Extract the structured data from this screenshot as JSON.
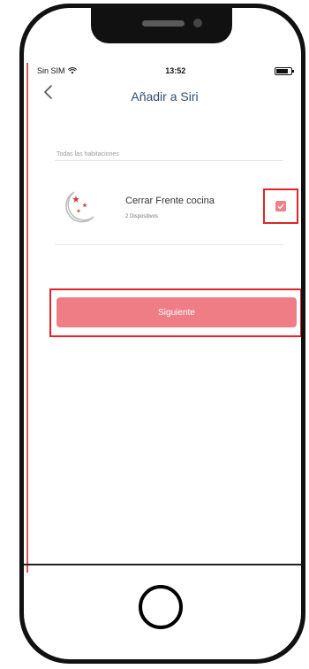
{
  "status_bar": {
    "carrier": "Sin SIM",
    "time": "13:52",
    "wifi_icon": "wifi-icon",
    "battery_icon": "battery-icon"
  },
  "nav": {
    "back_icon": "chevron-left-icon",
    "title": "Añadir a Siri"
  },
  "section": {
    "label": "Todas las habitaciones"
  },
  "device": {
    "icon": "moon-stars-icon",
    "name": "Cerrar Frente cocina",
    "subtitle": "2 Dispositivos",
    "checked": true
  },
  "buttons": {
    "next": "Siguiente"
  },
  "colors": {
    "accent": "#ef7d86",
    "highlight": "#e1242a",
    "title": "#2f4f70"
  }
}
